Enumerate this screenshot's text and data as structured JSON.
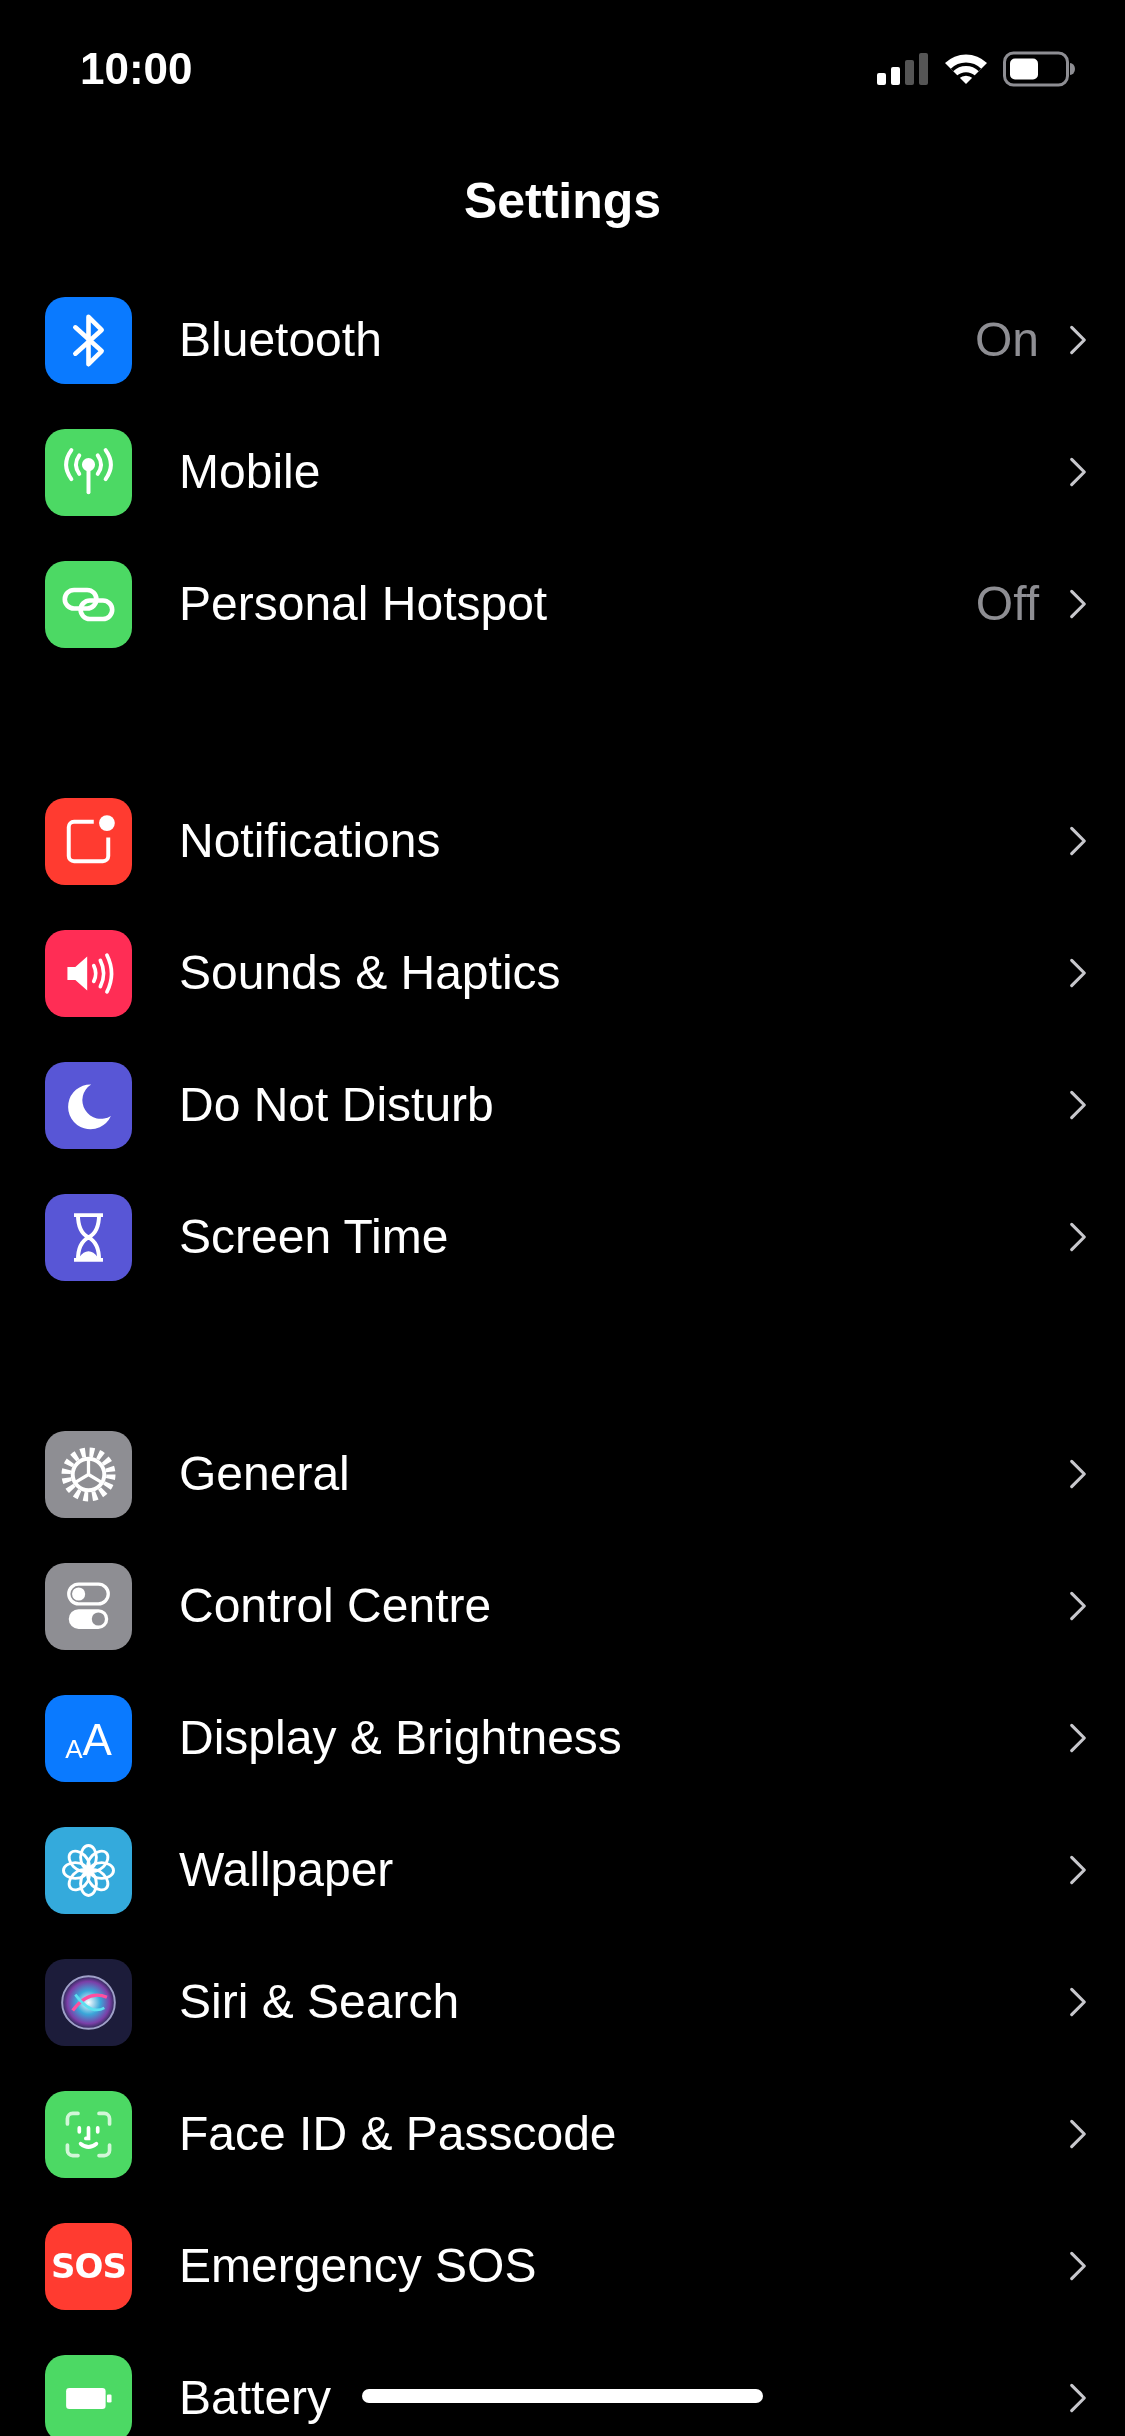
{
  "status_bar": {
    "time": "10:00"
  },
  "title": "Settings",
  "groups": [
    {
      "rows": [
        {
          "kind": "bluetooth",
          "color": "#0a7aff",
          "label": "Bluetooth",
          "value": "On"
        },
        {
          "kind": "antenna",
          "color": "#4cd964",
          "label": "Mobile"
        },
        {
          "kind": "link",
          "color": "#4cd964",
          "label": "Personal Hotspot",
          "value": "Off"
        }
      ]
    },
    {
      "rows": [
        {
          "kind": "notification",
          "color": "#ff3b30",
          "label": "Notifications"
        },
        {
          "kind": "speaker",
          "color": "#ff2d55",
          "label": "Sounds & Haptics"
        },
        {
          "kind": "moon",
          "color": "#5856d6",
          "label": "Do Not Disturb"
        },
        {
          "kind": "hourglass",
          "color": "#5856d6",
          "label": "Screen Time"
        }
      ]
    },
    {
      "rows": [
        {
          "kind": "gear",
          "color": "#8e8e93",
          "label": "General"
        },
        {
          "kind": "toggles",
          "color": "#8e8e93",
          "label": "Control Centre"
        },
        {
          "kind": "letters",
          "color": "#0a7aff",
          "label": "Display & Brightness",
          "icon_text": [
            "A",
            "A"
          ]
        },
        {
          "kind": "flower",
          "color": "#34aadc",
          "label": "Wallpaper"
        },
        {
          "kind": "orb",
          "color": "#1c1c3a",
          "label": "Siri & Search"
        },
        {
          "kind": "face",
          "color": "#4cd964",
          "label": "Face ID & Passcode"
        },
        {
          "kind": "sos",
          "color": "#ff3b30",
          "label": "Emergency SOS",
          "icon_text": [
            "SOS"
          ]
        },
        {
          "kind": "battery",
          "color": "#4cd964",
          "label": "Battery"
        }
      ]
    }
  ]
}
